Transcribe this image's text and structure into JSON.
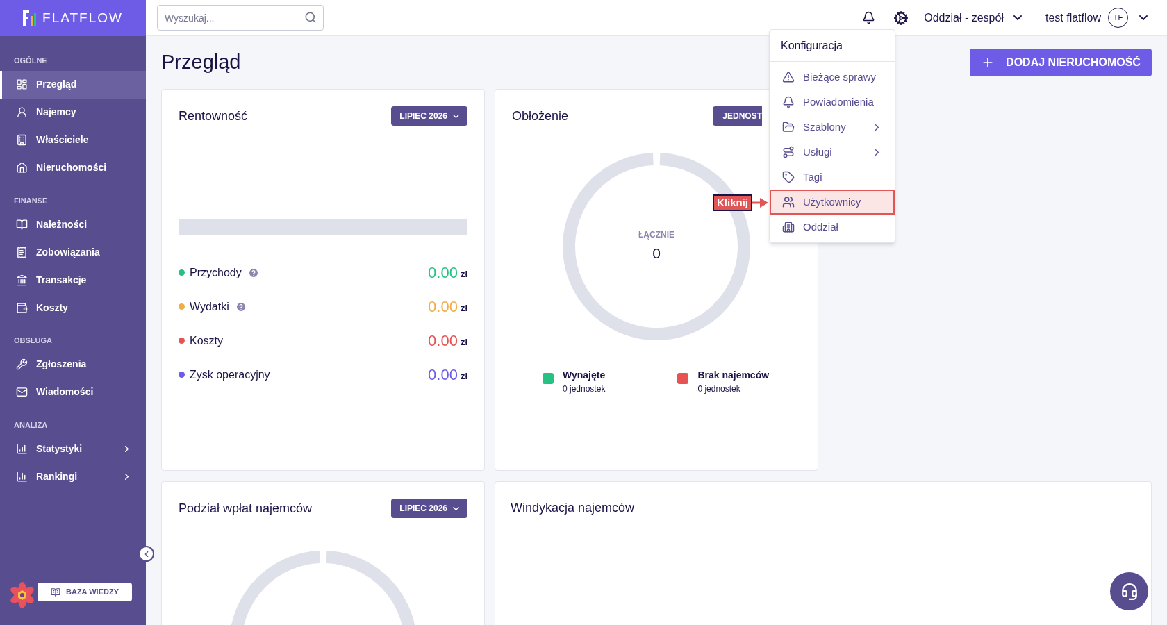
{
  "brand": "FLATFLOW",
  "search": {
    "placeholder": "Wyszukaj..."
  },
  "sidebar": {
    "sections": [
      {
        "title": "OGÓLNE",
        "items": [
          {
            "label": "Przegląd",
            "selected": true,
            "kind": "link"
          },
          {
            "label": "Najemcy",
            "selected": false,
            "kind": "link"
          },
          {
            "label": "Właściciele",
            "selected": false,
            "kind": "link"
          },
          {
            "label": "Nieruchomości",
            "selected": false,
            "kind": "link"
          }
        ]
      },
      {
        "title": "FINANSE",
        "items": [
          {
            "label": "Należności",
            "selected": false,
            "kind": "link"
          },
          {
            "label": "Zobowiązania",
            "selected": false,
            "kind": "link"
          },
          {
            "label": "Transakcje",
            "selected": false,
            "kind": "link"
          },
          {
            "label": "Koszty",
            "selected": false,
            "kind": "link"
          }
        ]
      },
      {
        "title": "OBSŁUGA",
        "items": [
          {
            "label": "Zgłoszenia",
            "selected": false,
            "kind": "link"
          },
          {
            "label": "Wiadomości",
            "selected": false,
            "kind": "link"
          }
        ]
      },
      {
        "title": "ANALIZA",
        "items": [
          {
            "label": "Statystyki",
            "selected": false,
            "kind": "submenu"
          },
          {
            "label": "Rankingi",
            "selected": false,
            "kind": "submenu"
          }
        ]
      }
    ],
    "knowledge_button": "BAZA WIEDZY"
  },
  "header": {
    "branch": "Oddział - zespół",
    "user": "test flatflow",
    "avatar": "TF"
  },
  "page_title": "Przegląd",
  "add_button": "DODAJ NIERUCHOMOŚĆ",
  "profitability": {
    "title": "Rentowność",
    "period": "LIPIEC 2026",
    "metrics": [
      {
        "label": "Przychody",
        "help": true,
        "value": "0.00",
        "currency": "zł",
        "color": "#27c283"
      },
      {
        "label": "Wydatki",
        "help": true,
        "value": "0.00",
        "currency": "zł",
        "color": "#f0ac45"
      },
      {
        "label": "Koszty",
        "help": false,
        "value": "0.00",
        "currency": "zł",
        "color": "#e55353"
      },
      {
        "label": "Zysk operacyjny",
        "help": false,
        "value": "0.00",
        "currency": "zł",
        "color": "#6c5ce7"
      }
    ]
  },
  "occupancy": {
    "title": "Obłożenie",
    "filter": "JEDNOST",
    "total_label": "ŁĄCZNIE",
    "total": "0",
    "legend": [
      {
        "label": "Wynajęte",
        "count": "0 jednostek",
        "color": "#27c283"
      },
      {
        "label": "Brak najemców",
        "count": "0 jednostek",
        "color": "#e55353"
      }
    ]
  },
  "payments": {
    "title": "Podział wpłat najemców",
    "period": "LIPIEC 2026"
  },
  "collection": {
    "title": "Windykacja najemców"
  },
  "config_menu": {
    "title": "Konfiguracja",
    "items": [
      {
        "label": "Bieżące sprawy",
        "kind": "link",
        "selected": false
      },
      {
        "label": "Powiadomienia",
        "kind": "link",
        "selected": false
      },
      {
        "label": "Szablony",
        "kind": "submenu",
        "selected": false
      },
      {
        "label": "Usługi",
        "kind": "submenu",
        "selected": false
      },
      {
        "label": "Tagi",
        "kind": "link",
        "selected": false
      },
      {
        "label": "Użytkownicy",
        "kind": "link",
        "selected": true
      },
      {
        "label": "Oddział",
        "kind": "link",
        "selected": false
      }
    ]
  },
  "callout": "Kliknij"
}
